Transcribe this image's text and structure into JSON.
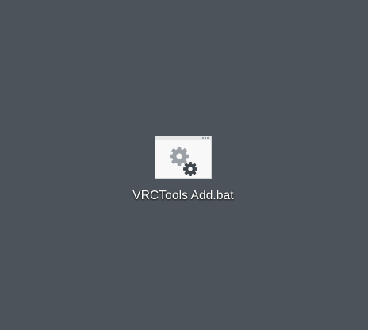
{
  "desktop": {
    "background_color": "#4c535a",
    "icons": [
      {
        "label": "VRCTools Add.bat",
        "icon": "batch-file-gears-icon",
        "colors": {
          "large_gear": "#9aa0a6",
          "small_gear": "#3f464c",
          "thumbnail_bg": "#f8f8f8"
        }
      }
    ]
  }
}
